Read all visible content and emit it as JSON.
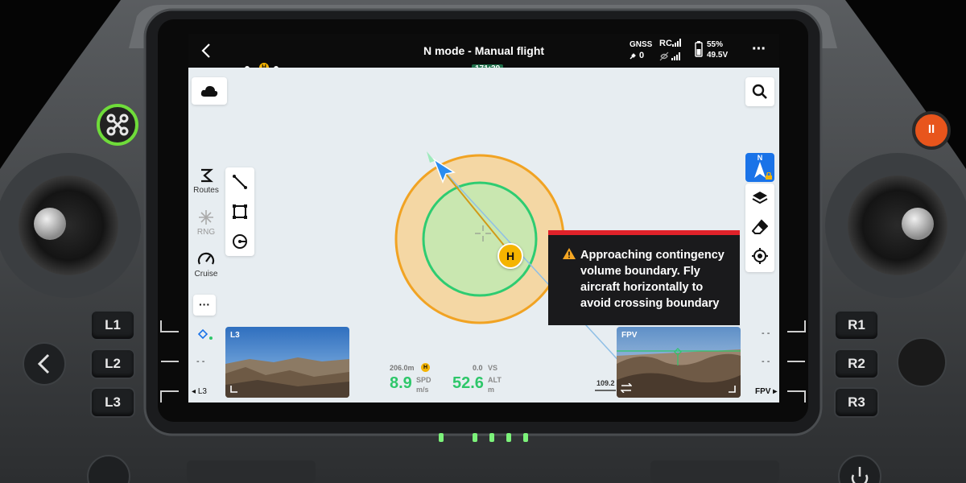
{
  "topbar": {
    "title": "N mode - Manual flight",
    "gnss_label": "GNSS",
    "gnss_count": "0",
    "rc_label": "RC",
    "battery_percent": "55%",
    "battery_voltage": "49.5V",
    "timeline_value": "171:29"
  },
  "left_tools": {
    "routes_label": "Routes",
    "rng_label": "RNG",
    "cruise_label": "Cruise",
    "more_label": "···"
  },
  "map": {
    "home_label": "H",
    "compass_label": "N"
  },
  "warning": {
    "line1": "Approaching contingency",
    "line2": "volume boundary. Fly",
    "line3": "aircraft horizontally to",
    "line4": "avoid crossing boundary"
  },
  "cameras": {
    "left_label": "L3",
    "left_bottom_label": "L3",
    "right_label": "FPV",
    "right_bottom_label": "FPV"
  },
  "telemetry": {
    "distance": "206.0m",
    "home_marker": "H",
    "spd_value": "8.9",
    "spd_label": "SPD",
    "spd_unit": "m/s",
    "vs_value": "0.0",
    "vs_label": "VS",
    "alt_value": "52.6",
    "alt_label": "ALT",
    "alt_unit": "m",
    "scale_value": "109.2"
  },
  "side_dashes": {
    "left1": "- -",
    "right1": "- -",
    "right2": "- -"
  },
  "hardware": {
    "l1": "L1",
    "l2": "L2",
    "l3": "L3",
    "r1": "R1",
    "r2": "R2",
    "r3": "R3",
    "pause_label": "II"
  },
  "colors": {
    "accent_blue": "#1a73e8",
    "warning_red": "#e0222a",
    "telemetry_green": "#2ec76a",
    "boundary_orange": "#f1a323"
  }
}
